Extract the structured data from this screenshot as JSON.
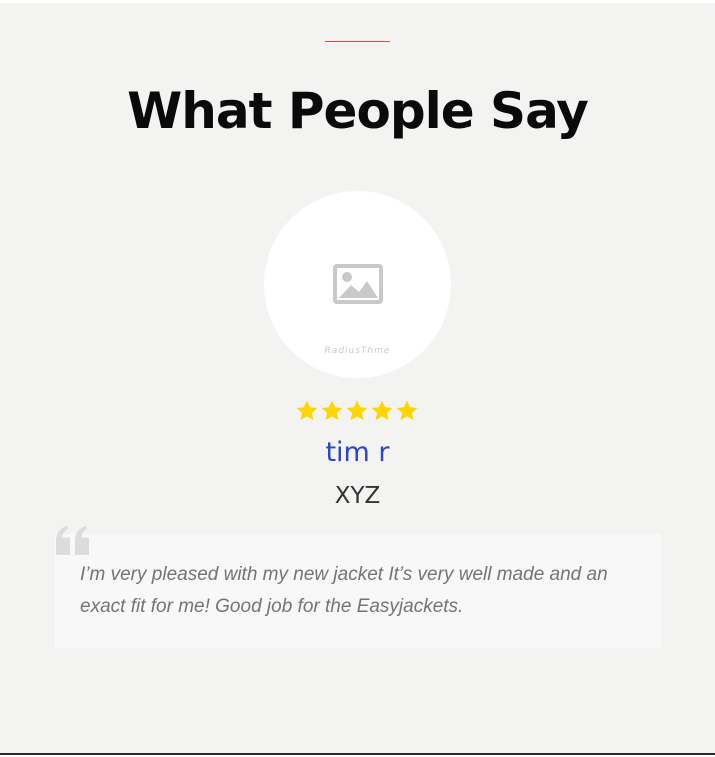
{
  "section": {
    "title": "What People Say"
  },
  "testimonial": {
    "avatar_icon": "image-placeholder-icon",
    "avatar_watermark": "RadiusThme",
    "rating": 5,
    "rating_max": 5,
    "name": "tim r",
    "company": "XYZ",
    "quote": "I’m very pleased with my new jacket It’s very well made and an exact fit for me! Good job for the Easyjackets.",
    "quote_icon": "quote-mark-icon"
  },
  "colors": {
    "background": "#f3f3f2",
    "accent_line": "#e24a3b",
    "name": "#2b47c9",
    "star": "#ffd500",
    "quote_text": "#747474"
  }
}
